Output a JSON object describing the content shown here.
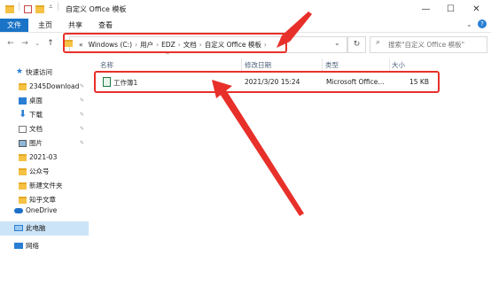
{
  "window": {
    "title": "自定义 Office 模板",
    "controls": [
      "—",
      "☐",
      "✕"
    ]
  },
  "ribbon": {
    "tabs": [
      {
        "label": "文件",
        "active": true
      },
      {
        "label": "主页",
        "active": false
      },
      {
        "label": "共享",
        "active": false
      },
      {
        "label": "查看",
        "active": false
      }
    ]
  },
  "address": {
    "overflow": "«",
    "crumbs": [
      "Windows (C:)",
      "用户",
      "EDZ",
      "文档",
      "自定义 Office 模板"
    ],
    "dropdown": "⌄",
    "refresh": "↻"
  },
  "search": {
    "placeholder": "搜索\"自定义 Office 模板\""
  },
  "nav_pane": {
    "quick_access": "快速访问",
    "items": [
      {
        "label": "2345Download",
        "icon": "folder-icon",
        "pinned": true
      },
      {
        "label": "桌面",
        "icon": "desktop-icon",
        "pinned": true
      },
      {
        "label": "下载",
        "icon": "download-icon",
        "pinned": true
      },
      {
        "label": "文档",
        "icon": "document-icon",
        "pinned": true
      },
      {
        "label": "图片",
        "icon": "picture-icon",
        "pinned": true
      },
      {
        "label": "2021-03",
        "icon": "folder-icon",
        "pinned": false
      },
      {
        "label": "公众号",
        "icon": "folder-icon",
        "pinned": false
      },
      {
        "label": "新建文件夹",
        "icon": "folder-icon",
        "pinned": false
      },
      {
        "label": "知乎文章",
        "icon": "folder-icon",
        "pinned": false
      }
    ],
    "onedrive": "OneDrive",
    "this_pc": "此电脑",
    "network": "网络"
  },
  "file_list": {
    "columns": [
      "名称",
      "修改日期",
      "类型",
      "大小"
    ],
    "sort_indicator": "^",
    "rows": [
      {
        "name": "工作簿1",
        "modified": "2021/3/20 15:24",
        "type": "Microsoft Office...",
        "size": "15 KB"
      }
    ]
  },
  "colors": {
    "accent": "#1a73c6",
    "annotation": "#e8302a",
    "folder": "#f6c244",
    "selected": "#cce4f7"
  }
}
